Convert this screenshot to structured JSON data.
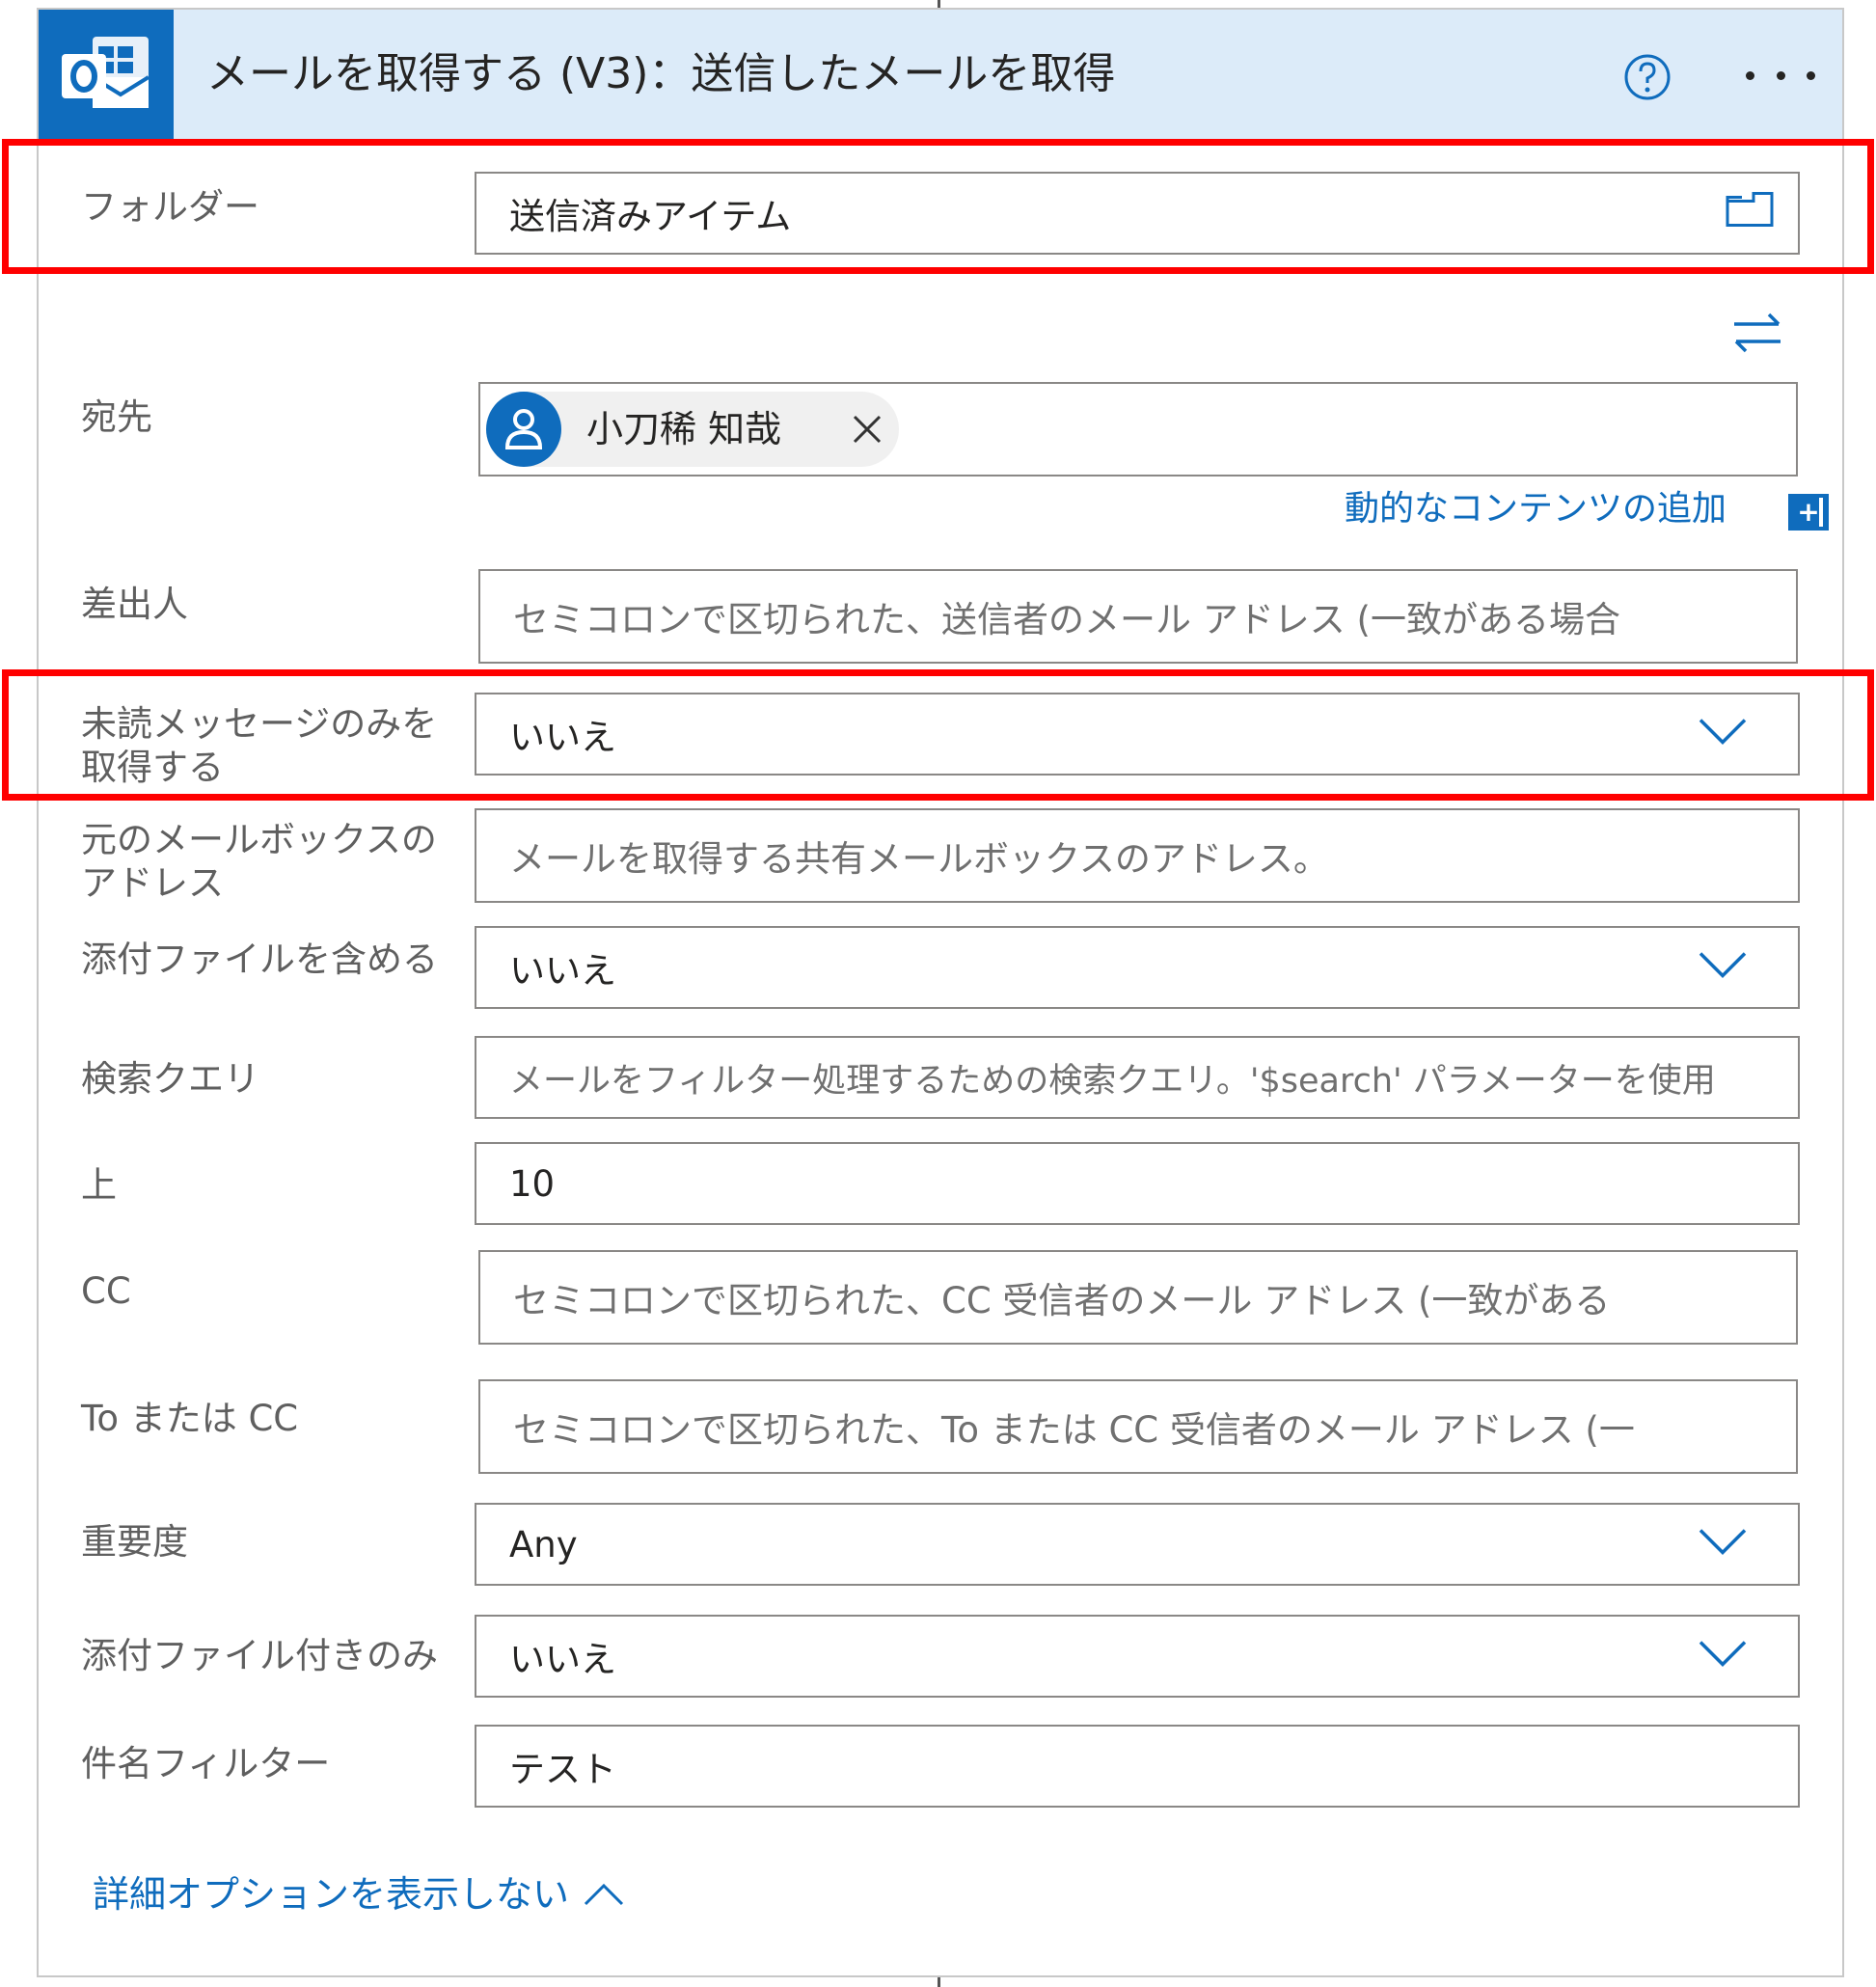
{
  "header": {
    "title": "メールを取得する (V3)：送信したメールを取得",
    "icon": "outlook-icon"
  },
  "fields": {
    "folder": {
      "label": "フォルダー",
      "value": "送信済みアイテム"
    },
    "to": {
      "label": "宛先",
      "chip_name": "小刀稀 知哉",
      "add_dynamic": "動的なコンテンツの追加"
    },
    "from": {
      "label": "差出人",
      "placeholder": "セミコロンで区切られた、送信者のメール アドレス (一致がある場合"
    },
    "unread": {
      "label": "未読メッセージのみを取得する",
      "value": "いいえ"
    },
    "mailbox": {
      "label": "元のメールボックスのアドレス",
      "placeholder": "メールを取得する共有メールボックスのアドレス。"
    },
    "attachments": {
      "label": "添付ファイルを含める",
      "value": "いいえ"
    },
    "search": {
      "label": "検索クエリ",
      "placeholder": "メールをフィルター処理するための検索クエリ。'$search' パラメーターを使用"
    },
    "top": {
      "label": "上",
      "value": "10"
    },
    "cc": {
      "label": "CC",
      "placeholder": "セミコロンで区切られた、CC 受信者のメール アドレス (一致がある"
    },
    "to_or_cc": {
      "label": "To または CC",
      "placeholder": "セミコロンで区切られた、To または CC 受信者のメール アドレス (一"
    },
    "importance": {
      "label": "重要度",
      "value": "Any"
    },
    "only_attach": {
      "label": "添付ファイル付きのみ",
      "value": "いいえ"
    },
    "subject": {
      "label": "件名フィルター",
      "value": "テスト"
    }
  },
  "advanced_toggle": "詳細オプションを表示しない",
  "colors": {
    "accent": "#0f6cbd",
    "header_bg": "#dcebf9",
    "highlight": "#ff0000"
  }
}
